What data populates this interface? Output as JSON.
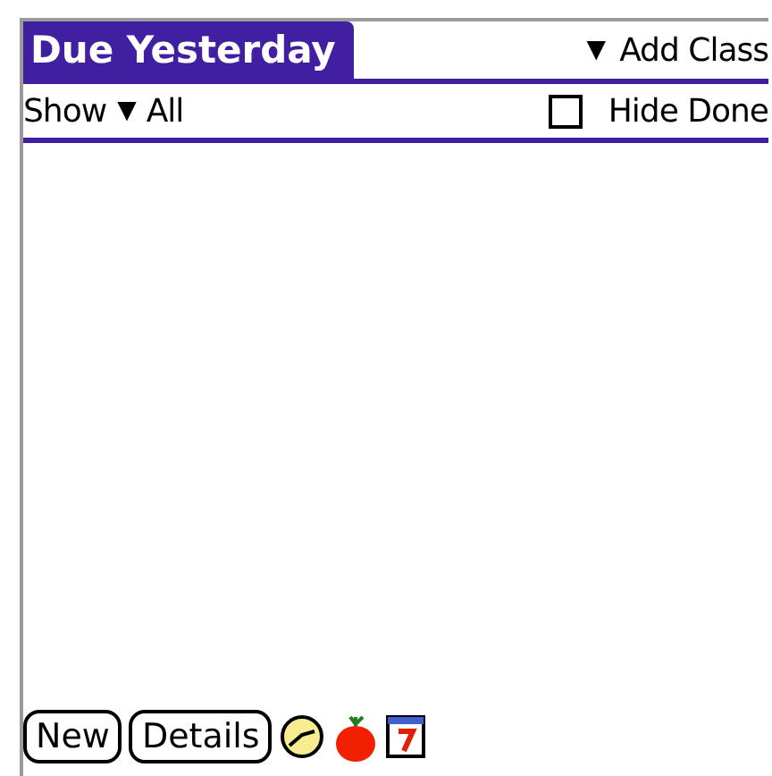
{
  "title": "Due Yesterday",
  "class_picker": {
    "arrow": "▼",
    "label": "Add Class"
  },
  "filter": {
    "label": "Show",
    "arrow": "▼",
    "value": "All"
  },
  "hide_done": {
    "label": "Hide Done",
    "checked": false
  },
  "buttons": [
    "New",
    "Details"
  ]
}
